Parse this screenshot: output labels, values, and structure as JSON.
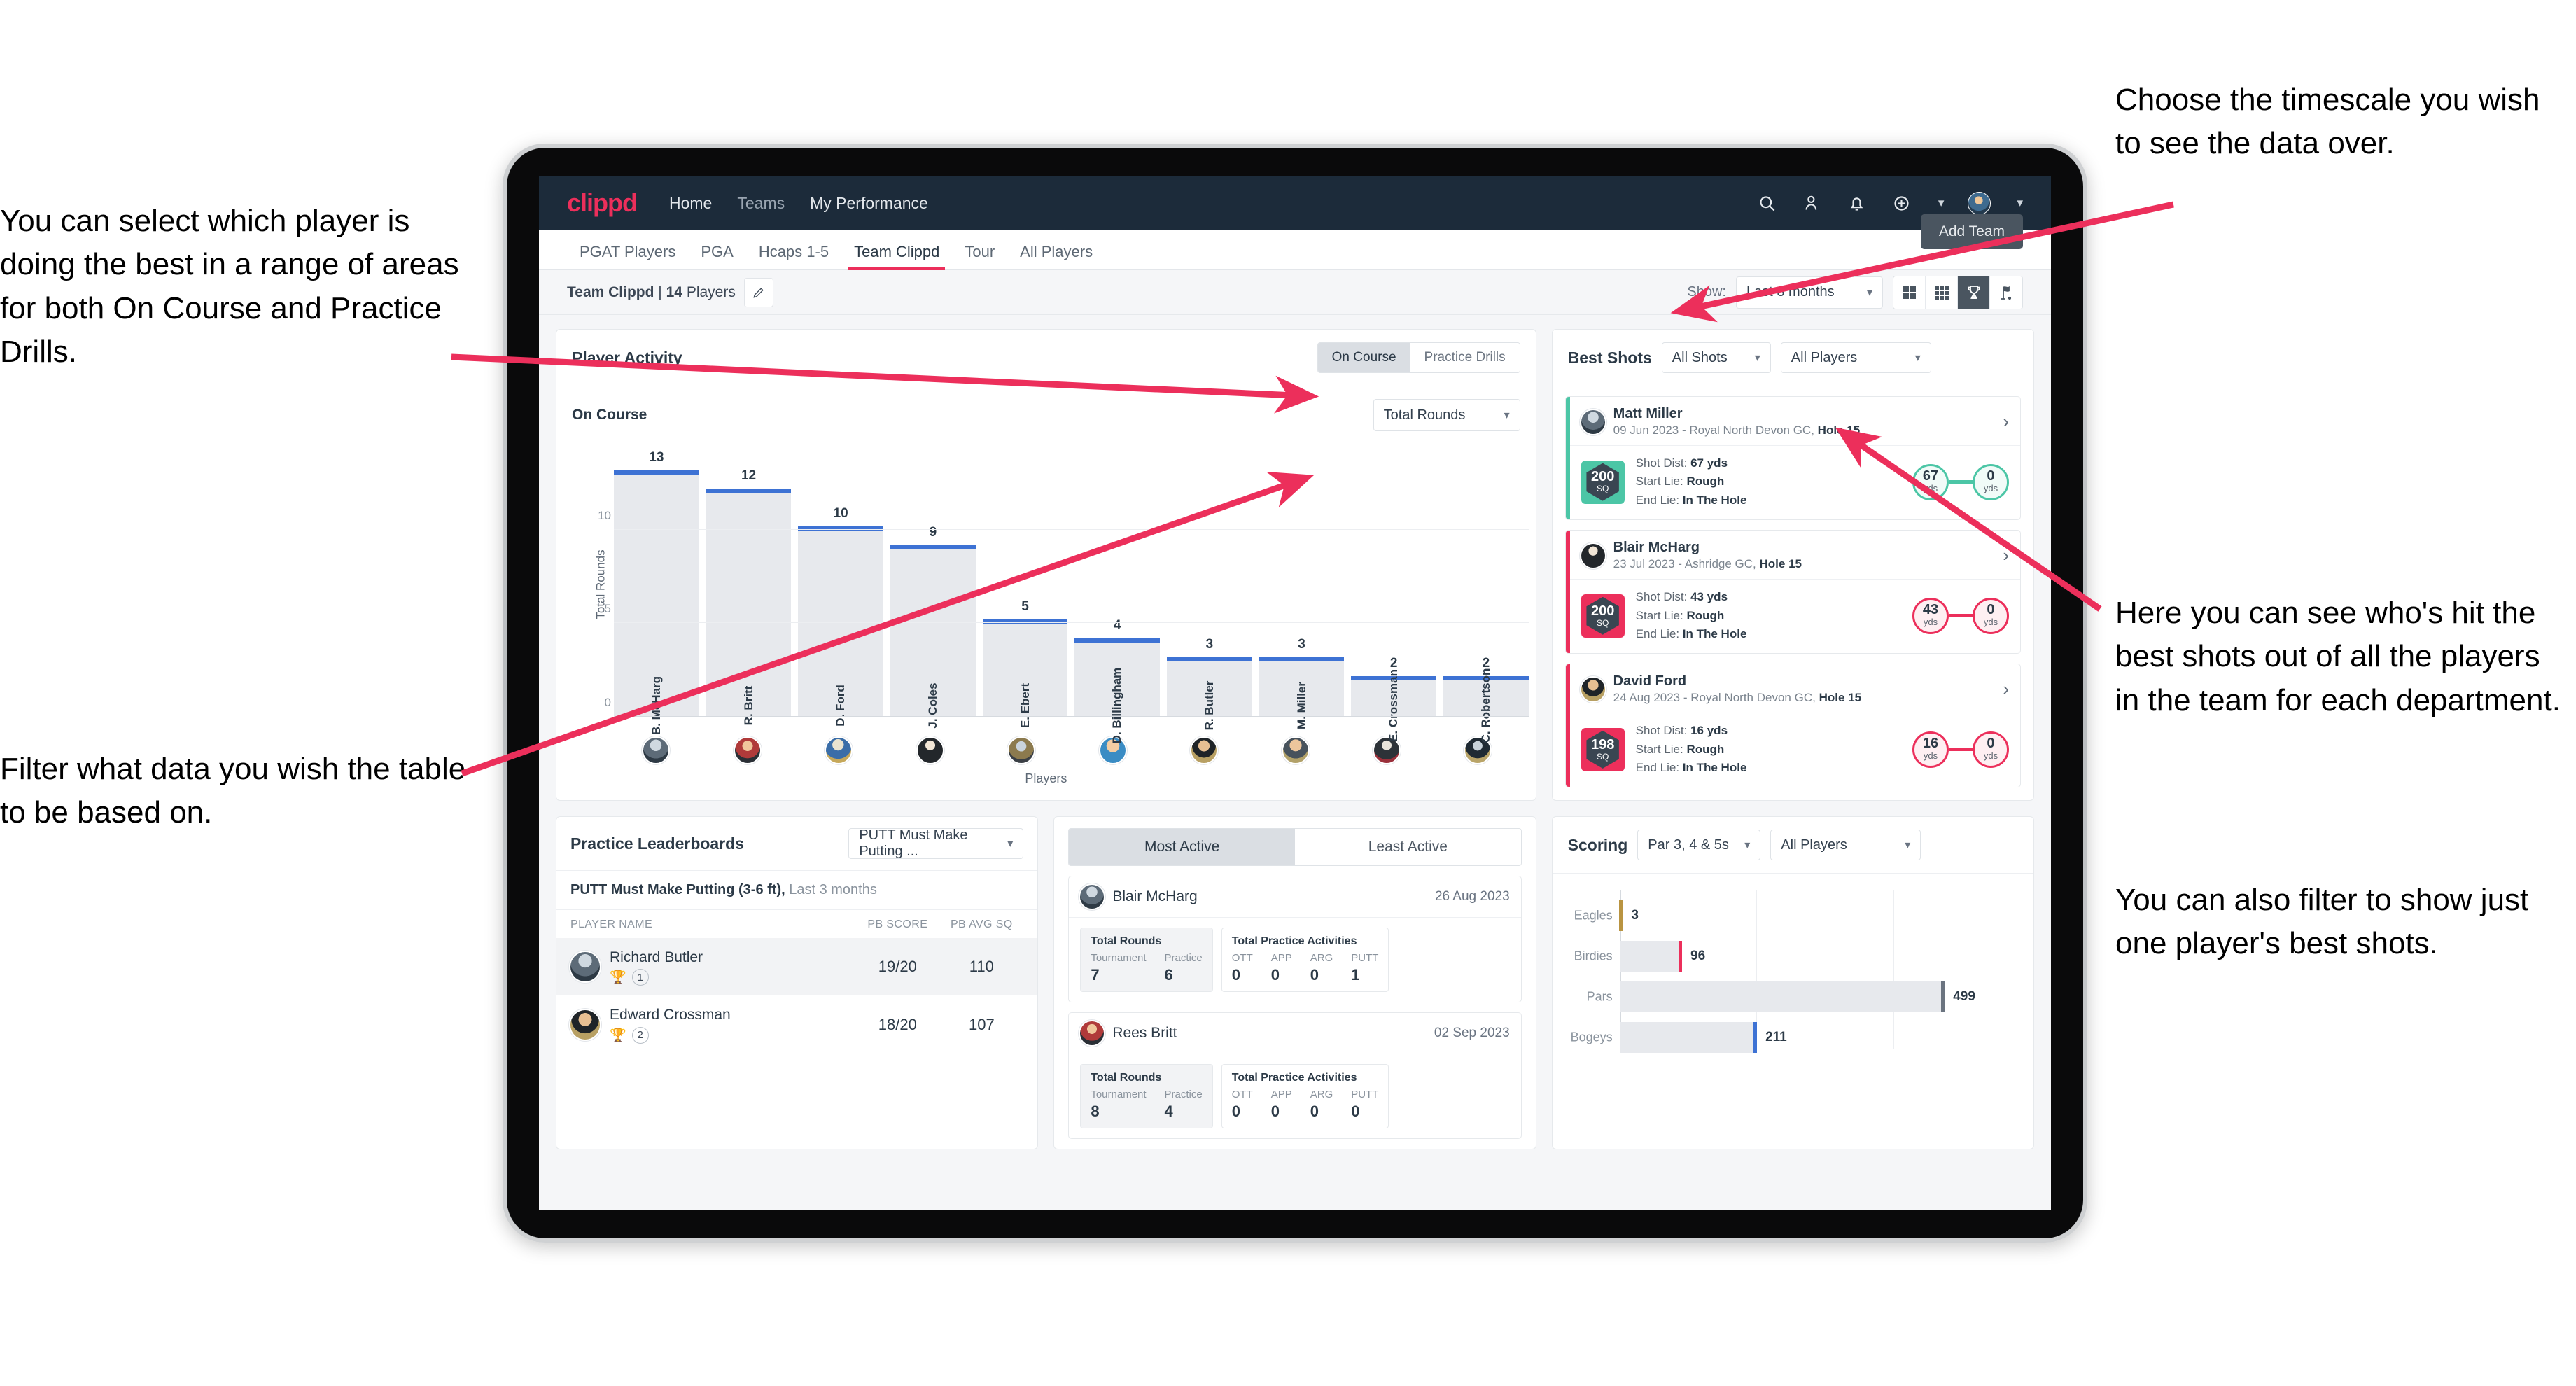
{
  "annotations": {
    "left_top": "You can select which player is doing the best in a range of areas for both On Course and Practice Drills.",
    "left_bottom": "Filter what data you wish the table to be based on.",
    "right_top": "Choose the timescale you wish to see the data over.",
    "right_middle": "Here you can see who's hit the best shots out of all the players in the team for each department.",
    "right_bottom": "You can also filter to show just one player's best shots."
  },
  "colors": {
    "brand_pink": "#ec2f5b",
    "nav_dark": "#1c2b3a",
    "bar_blue": "#3d72d4",
    "teal": "#4cc6a6",
    "gold": "#b99441"
  },
  "topnav": {
    "logo": "clippd",
    "links": [
      "Home",
      "Teams",
      "My Performance"
    ],
    "icons": [
      "search-icon",
      "people-icon",
      "bell-icon",
      "add-circle-icon",
      "avatar"
    ]
  },
  "tabs": {
    "items": [
      "PGAT Players",
      "PGA",
      "Hcaps 1-5",
      "Team Clippd",
      "Tour",
      "All Players"
    ],
    "active": "Team Clippd",
    "add_team_label": "Add Team"
  },
  "subbar": {
    "team_name": "Team Clippd",
    "team_count": "14",
    "team_count_suffix": "Players",
    "separator": "|",
    "show_label": "Show:",
    "timescale_value": "Last 3 months",
    "view_toggles": [
      "grid-2x2-icon",
      "grid-3x3-icon",
      "trophy-icon",
      "flag-icon"
    ],
    "active_view": "trophy-icon"
  },
  "player_activity": {
    "title": "Player Activity",
    "segments": [
      "On Course",
      "Practice Drills"
    ],
    "active_segment": "On Course",
    "subtitle": "On Course",
    "metric_select": "Total Rounds"
  },
  "chart_data": {
    "type": "bar",
    "title": "Player Activity — On Course",
    "xlabel": "Players",
    "ylabel": "Total Rounds",
    "ylim": [
      0,
      14
    ],
    "yticks": [
      0,
      5,
      10
    ],
    "grid": true,
    "categories": [
      "B. McHarg",
      "R. Britt",
      "D. Ford",
      "J. Coles",
      "E. Ebert",
      "D. Billingham",
      "R. Butler",
      "M. Miller",
      "E. Crossman",
      "C. Robertson"
    ],
    "values": [
      13,
      12,
      10,
      9,
      5,
      4,
      3,
      3,
      2,
      2
    ]
  },
  "best_shots": {
    "title": "Best Shots",
    "shot_filter": "All Shots",
    "player_filter": "All Players",
    "items": [
      {
        "name": "Matt Miller",
        "meta_date": "09 Jun 2023",
        "meta_course": "Royal North Devon GC,",
        "meta_hole": "Hole 15",
        "sq_value": "200",
        "sq_unit": "SQ",
        "shot_dist_label": "Shot Dist:",
        "shot_dist_value": "67 yds",
        "start_lie_label": "Start Lie:",
        "start_lie_value": "Rough",
        "end_lie_label": "End Lie:",
        "end_lie_value": "In The Hole",
        "from_value": "67",
        "from_unit": "yds",
        "to_value": "0",
        "to_unit": "yds",
        "accent": "#4cc6a6"
      },
      {
        "name": "Blair McHarg",
        "meta_date": "23 Jul 2023",
        "meta_course": "Ashridge GC,",
        "meta_hole": "Hole 15",
        "sq_value": "200",
        "sq_unit": "SQ",
        "shot_dist_label": "Shot Dist:",
        "shot_dist_value": "43 yds",
        "start_lie_label": "Start Lie:",
        "start_lie_value": "Rough",
        "end_lie_label": "End Lie:",
        "end_lie_value": "In The Hole",
        "from_value": "43",
        "from_unit": "yds",
        "to_value": "0",
        "to_unit": "yds",
        "accent": "#ec2f5b"
      },
      {
        "name": "David Ford",
        "meta_date": "24 Aug 2023",
        "meta_course": "Royal North Devon GC,",
        "meta_hole": "Hole 15",
        "sq_value": "198",
        "sq_unit": "SQ",
        "shot_dist_label": "Shot Dist:",
        "shot_dist_value": "16 yds",
        "start_lie_label": "Start Lie:",
        "start_lie_value": "Rough",
        "end_lie_label": "End Lie:",
        "end_lie_value": "In The Hole",
        "from_value": "16",
        "from_unit": "yds",
        "to_value": "0",
        "to_unit": "yds",
        "accent": "#ec2f5b"
      }
    ]
  },
  "practice_leaderboards": {
    "title": "Practice Leaderboards",
    "drill_select": "PUTT Must Make Putting ...",
    "subtitle_bold": "PUTT Must Make Putting (3-6 ft),",
    "subtitle_rest": "Last 3 months",
    "columns": [
      "PLAYER NAME",
      "PB SCORE",
      "PB AVG SQ"
    ],
    "rows": [
      {
        "name": "Richard Butler",
        "rank": "1",
        "trophy": "gold",
        "pb_score": "19/20",
        "pb_avg_sq": "110"
      },
      {
        "name": "Edward Crossman",
        "rank": "2",
        "trophy": "silver",
        "pb_score": "18/20",
        "pb_avg_sq": "107"
      }
    ]
  },
  "activity": {
    "tabs": [
      "Most Active",
      "Least Active"
    ],
    "active_tab": "Most Active",
    "rounds_label": "Total Rounds",
    "rounds_cols": [
      "Tournament",
      "Practice"
    ],
    "practice_label": "Total Practice Activities",
    "practice_cols": [
      "OTT",
      "APP",
      "ARG",
      "PUTT"
    ],
    "items": [
      {
        "name": "Blair McHarg",
        "date": "26 Aug 2023",
        "tournament": "7",
        "practice": "6",
        "ott": "0",
        "app": "0",
        "arg": "0",
        "putt": "1"
      },
      {
        "name": "Rees Britt",
        "date": "02 Sep 2023",
        "tournament": "8",
        "practice": "4",
        "ott": "0",
        "app": "0",
        "arg": "0",
        "putt": "0"
      }
    ]
  },
  "scoring": {
    "title": "Scoring",
    "par_filter": "Par 3, 4 & 5s",
    "player_filter": "All Players",
    "chart": {
      "type": "bar",
      "orientation": "horizontal",
      "categories": [
        "Eagles",
        "Birdies",
        "Pars",
        "Bogeys"
      ],
      "values": [
        3,
        96,
        499,
        211
      ],
      "xmax": 560,
      "colors": [
        "#b99441",
        "#ec2f5b",
        "#6b7480",
        "#3d72d4"
      ]
    }
  }
}
